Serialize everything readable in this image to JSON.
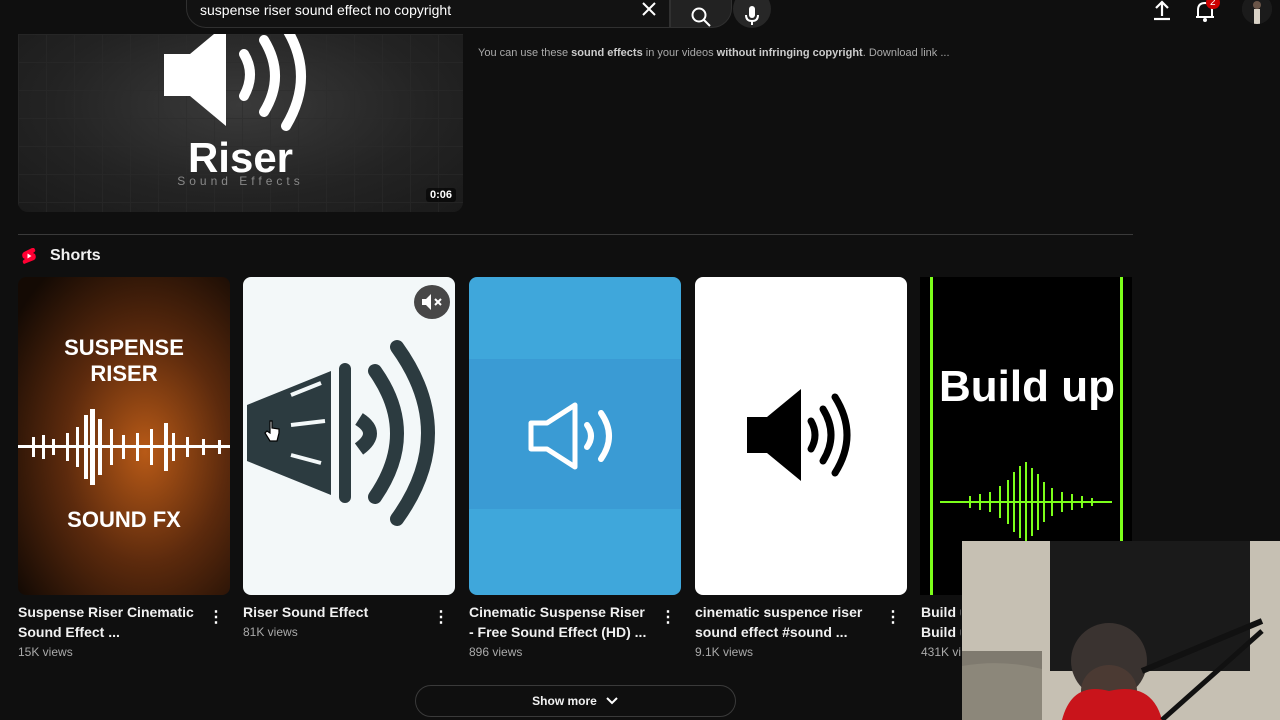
{
  "search": {
    "query": "suspense riser sound effect no copyright",
    "clear_icon": "close-icon",
    "search_icon": "search-icon",
    "mic_icon": "mic-icon"
  },
  "header": {
    "notification_count": "2"
  },
  "top_video": {
    "thumb_title": "Riser",
    "thumb_subtitle": "Sound Effects",
    "duration": "0:06",
    "desc_pre": "You can use these ",
    "desc_b1": "sound effects",
    "desc_mid": " in your videos ",
    "desc_b2": "without infringing copyright",
    "desc_post": ". Download link ..."
  },
  "shorts": {
    "heading": "Shorts",
    "items": [
      {
        "title": "Suspense Riser Cinematic Sound Effect ...",
        "views": "15K views",
        "thumb_top": "SUSPENSE RISER",
        "thumb_bottom": "SOUND FX"
      },
      {
        "title": "Riser Sound Effect",
        "views": "81K views"
      },
      {
        "title": "Cinematic Suspense Riser - Free Sound Effect (HD) ...",
        "views": "896 views"
      },
      {
        "title": "cinematic suspence riser sound effect #sound ...",
        "views": "9.1K views"
      },
      {
        "title": "Build u",
        "title_line2": "Build u",
        "views": "431K vi",
        "thumb_text": "Build up"
      }
    ]
  },
  "show_more": {
    "label": "Show more"
  },
  "colors": {
    "background": "#0f0f0f",
    "shorts_red": "#ff0033",
    "green_wave": "#7cff1a",
    "blue_thumb": "#3fa7db"
  }
}
